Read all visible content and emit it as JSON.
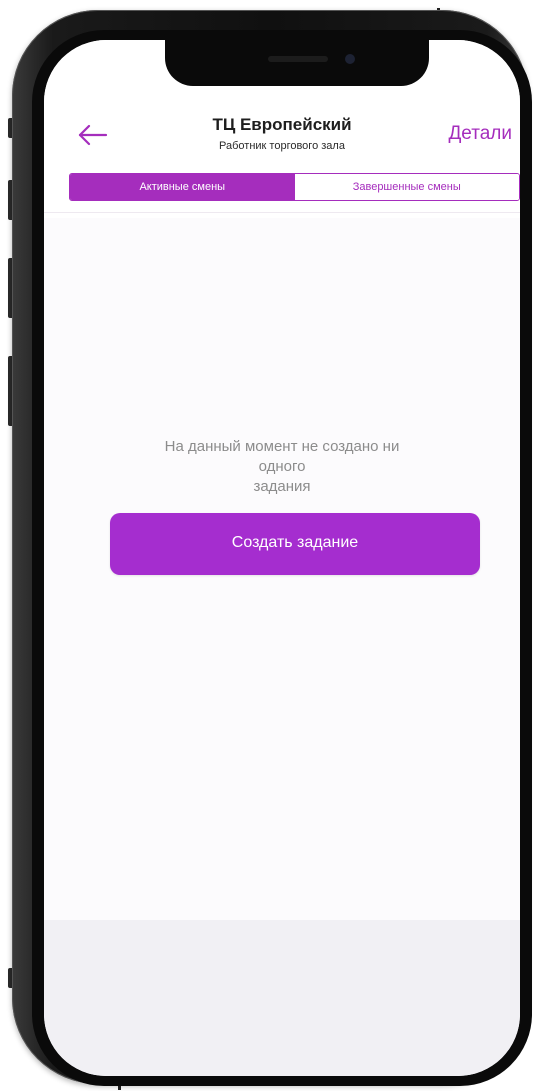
{
  "header": {
    "title": "ТЦ Европейский",
    "subtitle": "Работник торгового зала",
    "details_label": "Детали",
    "back_icon": "arrow-left-icon"
  },
  "tabs": [
    {
      "label": "Активные смены",
      "active": true
    },
    {
      "label": "Завершенные смены",
      "active": false
    }
  ],
  "empty_state": {
    "lines": [
      "На данный момент не создано ни",
      "одного",
      "задания"
    ]
  },
  "create_button": {
    "label": "Создать задание"
  },
  "colors": {
    "accent": "#a52dbd",
    "button": "#a52dcf",
    "empty_text": "#8c8c8c",
    "bottom_area": "#f1f0f4"
  }
}
